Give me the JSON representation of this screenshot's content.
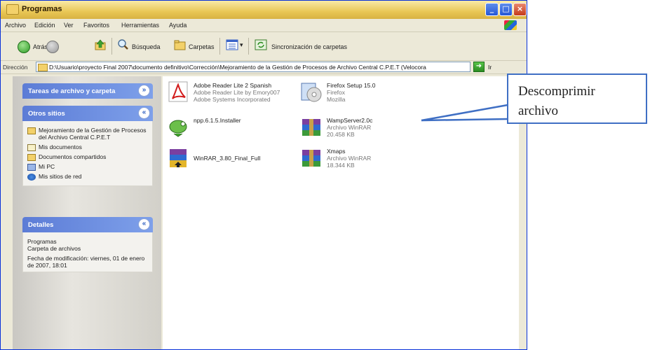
{
  "window": {
    "title": "Programas"
  },
  "menu": [
    "Archivo",
    "Edición",
    "Ver",
    "Favoritos",
    "Herramientas",
    "Ayuda"
  ],
  "toolbar": {
    "back_label": "Atrás",
    "search_label": "Búsqueda",
    "folders_label": "Carpetas",
    "sync_label": "Sincronización de carpetas"
  },
  "address": {
    "label": "Dirección",
    "value": "D:\\Usuario\\proyecto Final 2007\\documento definitivo\\Corrección\\Mejoramiento de la Gestión de Procesos de Archivo Central C.P.E.T (Velocora",
    "go_label": "Ir"
  },
  "left_panel": {
    "tasks_title": "Tareas de archivo y carpeta",
    "places_title": "Otros sitios",
    "places": [
      "Mejoramiento de la Gestión de Procesos del Archivo Central C.P.E.T",
      "Mis documentos",
      "Documentos compartidos",
      "Mi PC",
      "Mis sitios de red"
    ],
    "details_title": "Detalles",
    "details": {
      "name": "Programas",
      "type": "Carpeta de archivos",
      "modified": "Fecha de modificación: viernes, 01 de enero de 2007, 18:01"
    }
  },
  "files": [
    {
      "name": "Adobe Reader Lite 2 Spanish",
      "line2": "Adobe Reader Lite by Emory007",
      "line3": "Adobe Systems Incorporated",
      "icon": "pdf-icon"
    },
    {
      "name": "Firefox Setup 15.0",
      "line2": "Firefox",
      "line3": "Mozilla",
      "icon": "cd-installer-icon"
    },
    {
      "name": "npp.6.1.5.Installer",
      "line2": "",
      "line3": "",
      "icon": "notepad-chameleon-icon"
    },
    {
      "name": "WampServer2.0c",
      "line2": "Archivo WinRAR",
      "line3": "20.458 KB",
      "icon": "winrar-archive-icon"
    },
    {
      "name": "WinRAR_3.80_Final_Full",
      "line2": "",
      "line3": "",
      "icon": "winrar-installer-icon"
    },
    {
      "name": "Xmaps",
      "line2": "Archivo WinRAR",
      "line3": "18.344 KB",
      "icon": "winrar-archive-icon"
    }
  ],
  "callout": {
    "text": "Descomprimir archivo"
  }
}
